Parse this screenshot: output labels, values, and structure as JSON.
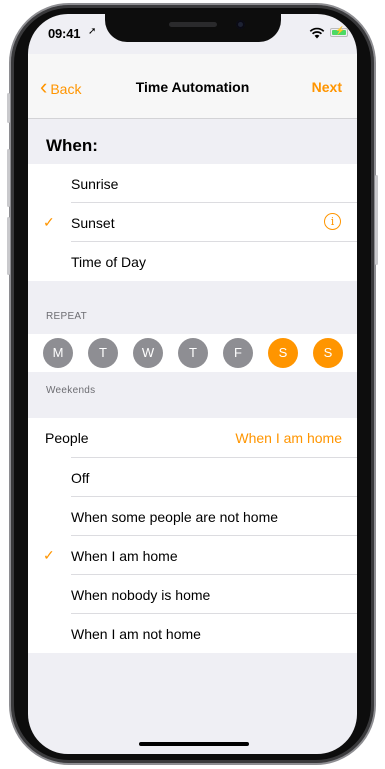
{
  "status_bar": {
    "time": "09:41",
    "location_icon": "location-arrow-icon",
    "wifi_icon": "wifi-icon",
    "battery_icon": "battery-charging-icon",
    "battery_bolt": "⚡"
  },
  "nav": {
    "back_label": "Back",
    "back_icon": "chevron-left-icon",
    "title": "Time Automation",
    "next_label": "Next"
  },
  "when": {
    "header": "When:",
    "options": [
      {
        "label": "Sunrise",
        "selected": false
      },
      {
        "label": "Sunset",
        "selected": true
      },
      {
        "label": "Time of Day",
        "selected": false
      }
    ],
    "info_icon": "info-icon",
    "info_glyph": "i",
    "check_glyph": "✓"
  },
  "repeat": {
    "header": "REPEAT",
    "days": [
      {
        "label": "M",
        "selected": false
      },
      {
        "label": "T",
        "selected": false
      },
      {
        "label": "W",
        "selected": false
      },
      {
        "label": "T",
        "selected": false
      },
      {
        "label": "F",
        "selected": false
      },
      {
        "label": "S",
        "selected": true
      },
      {
        "label": "S",
        "selected": true
      }
    ],
    "summary": "Weekends"
  },
  "people": {
    "label": "People",
    "value": "When I am home",
    "options": [
      {
        "label": "Off",
        "selected": false
      },
      {
        "label": "When some people are not home",
        "selected": false
      },
      {
        "label": "When I am home",
        "selected": true
      },
      {
        "label": "When nobody is home",
        "selected": false
      },
      {
        "label": "When I am not home",
        "selected": false
      }
    ]
  },
  "colors": {
    "accent": "#ff9500",
    "day_off": "#8e8e93",
    "day_on": "#ff9500",
    "background": "#efeff4"
  }
}
